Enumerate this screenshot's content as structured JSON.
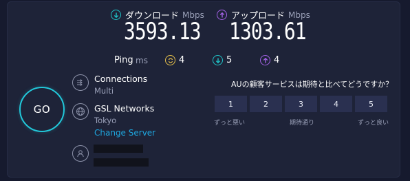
{
  "download": {
    "label": "ダウンロード",
    "unit": "Mbps",
    "value": "3593.13",
    "color": "#1fc3c7"
  },
  "upload": {
    "label": "アップロード",
    "unit": "Mbps",
    "value": "1303.61",
    "color": "#a462e6"
  },
  "ping": {
    "label": "Ping",
    "unit": "ms",
    "idle": "4",
    "download": "5",
    "upload": "4",
    "idle_color": "#e9c24b"
  },
  "go_label": "GO",
  "connections": {
    "title": "Connections",
    "value": "Multi"
  },
  "server": {
    "title": "GSL Networks",
    "location": "Tokyo",
    "change_label": "Change Server"
  },
  "survey": {
    "question": "AUの顧客サービスは期待と比べてどうですか？",
    "ratings": [
      "1",
      "2",
      "3",
      "4",
      "5"
    ],
    "low_label": "ずっと悪い",
    "mid_label": "期待通り",
    "high_label": "ずっと良い"
  },
  "accent": "#22c7d9"
}
